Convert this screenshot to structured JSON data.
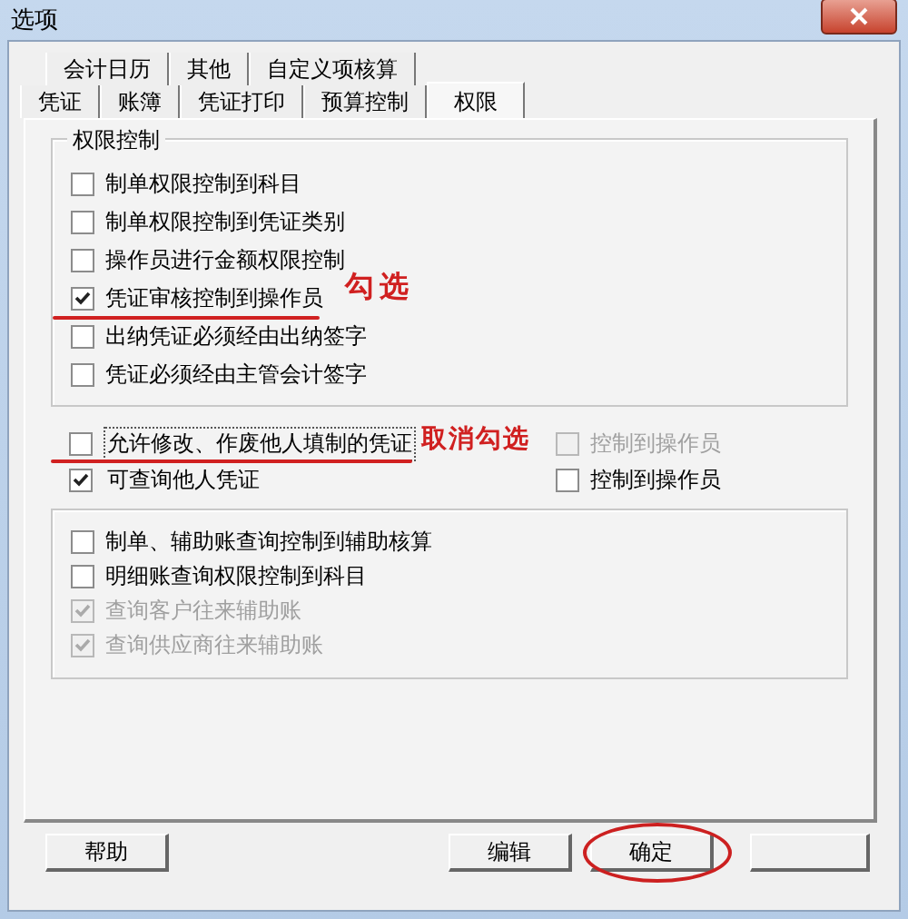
{
  "window": {
    "title": "选项"
  },
  "tabs_row_1": [
    {
      "label": "会计日历",
      "selected": false
    },
    {
      "label": "其他",
      "selected": false
    },
    {
      "label": "自定义项核算",
      "selected": false
    }
  ],
  "tabs_row_2": [
    {
      "label": "凭证",
      "selected": false
    },
    {
      "label": "账簿",
      "selected": false
    },
    {
      "label": "凭证打印",
      "selected": false
    },
    {
      "label": "预算控制",
      "selected": false
    },
    {
      "label": "权限",
      "selected": true
    }
  ],
  "permission_group": {
    "title": "权限控制",
    "options": [
      {
        "label": "制单权限控制到科目",
        "checked": false,
        "disabled": false
      },
      {
        "label": "制单权限控制到凭证类别",
        "checked": false,
        "disabled": false
      },
      {
        "label": "操作员进行金额权限控制",
        "checked": false,
        "disabled": false
      },
      {
        "label": "凭证审核控制到操作员",
        "checked": true,
        "disabled": false,
        "underlined": true,
        "note": "勾选"
      },
      {
        "label": "出纳凭证必须经由出纳签字",
        "checked": false,
        "disabled": false
      },
      {
        "label": "凭证必须经由主管会计签字",
        "checked": false,
        "disabled": false
      }
    ]
  },
  "voucher_options": [
    {
      "label": "允许修改、作废他人填制的凭证",
      "checked": false,
      "disabled": false,
      "underlined": true,
      "note": "取消勾选",
      "sub_option": {
        "label": "控制到操作员",
        "checked": false,
        "disabled": true
      }
    },
    {
      "label": "可查询他人凭证",
      "checked": true,
      "disabled": false,
      "sub_option": {
        "label": "控制到操作员",
        "checked": false,
        "disabled": false
      }
    }
  ],
  "query_group": {
    "options": [
      {
        "label": "制单、辅助账查询控制到辅助核算",
        "checked": false,
        "disabled": false
      },
      {
        "label": "明细账查询权限控制到科目",
        "checked": false,
        "disabled": false
      },
      {
        "label": "查询客户往来辅助账",
        "checked": true,
        "disabled": true
      },
      {
        "label": "查询供应商往来辅助账",
        "checked": true,
        "disabled": true
      }
    ]
  },
  "buttons": [
    {
      "label": "帮助",
      "circled": false
    },
    {
      "label": "编辑",
      "circled": false
    },
    {
      "label": "确定",
      "circled": true
    }
  ]
}
